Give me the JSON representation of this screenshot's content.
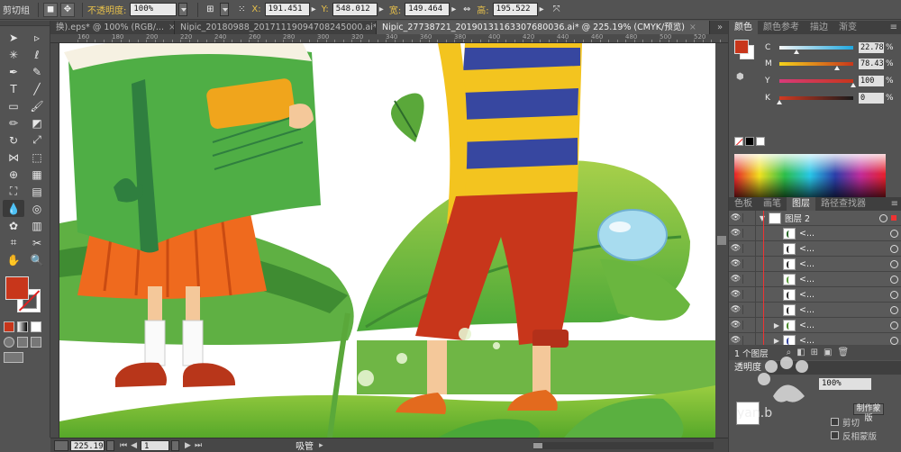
{
  "control_bar": {
    "selection_label": "剪切组",
    "opacity_label": "不透明度:",
    "opacity_value": "100%",
    "x_label": "X:",
    "x_value": "191.451",
    "y_label": "Y:",
    "y_value": "548.012",
    "w_label": "宽:",
    "w_value": "149.464",
    "h_label": "高:",
    "h_value": "195.522"
  },
  "tabs": [
    {
      "label": "换).eps* @ 100% (RGB/..."
    },
    {
      "label": "Nipic_20180988_20171119094708245000.ai*"
    },
    {
      "label": "Nipic_27738721_20190131163307680036.ai* @ 225.19% (CMYK/预览)"
    }
  ],
  "ruler_ticks": [
    "160",
    "180",
    "200",
    "220",
    "240",
    "260",
    "280",
    "300",
    "320",
    "340",
    "360",
    "380",
    "400",
    "420",
    "440",
    "460",
    "480",
    "500",
    "520",
    "540"
  ],
  "color_panel": {
    "tabs": [
      "颜色",
      "颜色参考",
      "描边",
      "渐变"
    ],
    "channels": [
      {
        "key": "C",
        "value": "22.78",
        "level": 0.2278,
        "colors": [
          "#f5f5f5",
          "#1fa8e0"
        ]
      },
      {
        "key": "M",
        "value": "78.43",
        "level": 0.7843,
        "colors": [
          "#f3d21c",
          "#c8361b"
        ]
      },
      {
        "key": "Y",
        "value": "100",
        "level": 1.0,
        "colors": [
          "#d83a7a",
          "#c8361b"
        ]
      },
      {
        "key": "K",
        "value": "0",
        "level": 0.0,
        "colors": [
          "#d23a22",
          "#1a1a1a"
        ]
      }
    ],
    "percent": "%",
    "fill_color": "#c8361b"
  },
  "layers_panel": {
    "tabs": [
      "色板",
      "画笔",
      "图层",
      "路径查找器"
    ],
    "layer_name": "图层 2",
    "sublayer_label": "<...",
    "footer_count": "1 个图层"
  },
  "transparency_panel": {
    "title": "透明度",
    "opacity_value": "100%",
    "make_mask_label": "制作蒙版",
    "clip_label": "剪切",
    "invert_mask_label": "反相蒙版"
  },
  "status_bar": {
    "zoom": "225.19",
    "page": "1",
    "tool": "吸管"
  },
  "watermark": {
    "text": "yan.b"
  }
}
